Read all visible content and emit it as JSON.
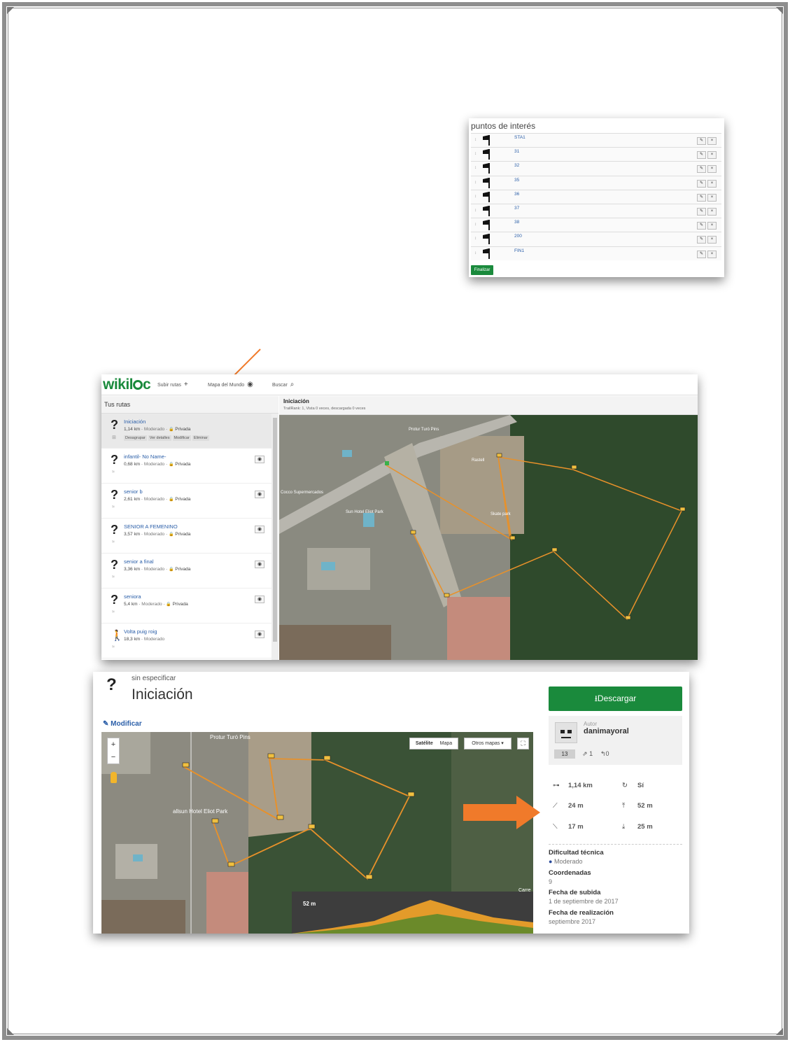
{
  "poi_panel": {
    "title": "puntos de interés",
    "points": [
      "STA1",
      "31",
      "32",
      "35",
      "36",
      "37",
      "38",
      "200",
      "FIN1"
    ],
    "edit_icon": "pencil-icon",
    "delete_icon": "x-icon",
    "finish_label": "Finalizar"
  },
  "wikiloc": {
    "logo": "wikiloc",
    "nav": {
      "upload": "Subir rutas",
      "world_map": "Mapa del Mundo",
      "search": "Buscar"
    },
    "sidebar_title": "Tus rutas",
    "routes": [
      {
        "name": "Iniciación",
        "distance": "1,14 km",
        "difficulty": "Moderado",
        "privacy": "Privada",
        "actions": [
          "Desagrupar",
          "Ver detalles",
          "Modificar",
          "Eliminar"
        ]
      },
      {
        "name": "infantil- No Name-",
        "distance": "0,68 km",
        "difficulty": "Moderado",
        "privacy": "Privada"
      },
      {
        "name": "senior b",
        "distance": "2,61 km",
        "difficulty": "Moderado",
        "privacy": "Privada"
      },
      {
        "name": "SENIOR A FEMENINO",
        "distance": "3,57 km",
        "difficulty": "Moderado",
        "privacy": "Privada"
      },
      {
        "name": "senior a final",
        "distance": "3,36 km",
        "difficulty": "Moderado",
        "privacy": "Privada"
      },
      {
        "name": "seniora",
        "distance": "5,4 km",
        "difficulty": "Moderado",
        "privacy": "Privada"
      },
      {
        "name": "Volta puig roig",
        "distance": "18,3 km",
        "difficulty": "Moderado",
        "privacy": ""
      }
    ],
    "map_title": "Iniciación",
    "map_subtitle": "TrailRank: 1,  Vista 0 veces, descargada 0 veces",
    "map_labels": {
      "pool": "Protur Turó Pins",
      "supermarket": "Cocco Supermercados",
      "hotel": "Sun Hotel Eliot Park",
      "skate": "Skate park",
      "roundabout": "Rastell"
    }
  },
  "detail": {
    "kind": "sin especificar",
    "title": "Iniciación",
    "modify": "Modificar",
    "download": "Descargar",
    "author_label": "Autor",
    "author_name": "danimayoral",
    "author_count": "13",
    "followers": "1",
    "following": "0",
    "stats": {
      "distance": "1,14 km",
      "loop": "Sí",
      "min_alt": "24 m",
      "max_alt": "52 m",
      "elev_loss_ico": "17 m",
      "descent": "25 m"
    },
    "tech_label": "Dificultad técnica",
    "tech_value": "Moderado",
    "coords_label": "Coordenadas",
    "coords_value": "9",
    "uploaded_label": "Fecha de subida",
    "uploaded_value": "1 de septiembre de 2017",
    "done_label": "Fecha de realización",
    "done_value": "septiembre 2017",
    "map_buttons": {
      "satellite": "Satélite",
      "map": "Mapa",
      "other": "Otros mapas"
    },
    "map_label": "Protur Turó Pins",
    "hotel_label": "allsun Hotel Eliot Park",
    "profile_label": "52 m",
    "street_label": "Carre"
  },
  "colors": {
    "route": "#e8912a",
    "green": "#1a8a3c",
    "link": "#2a5ea8",
    "arrow": "#f07a2a"
  }
}
